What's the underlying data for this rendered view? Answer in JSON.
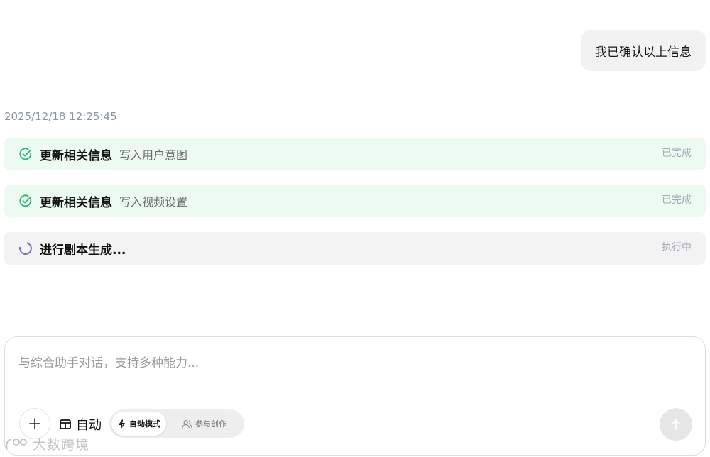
{
  "user_message": {
    "text": "我已确认以上信息"
  },
  "timestamp": "2025/12/18 12:25:45",
  "tasks": [
    {
      "title": "更新相关信息",
      "detail": "写入用户意图",
      "status": "已完成",
      "state": "done"
    },
    {
      "title": "更新相关信息",
      "detail": "写入视频设置",
      "status": "已完成",
      "state": "done"
    },
    {
      "title": "进行剧本生成...",
      "detail": "",
      "status": "执行中",
      "state": "running"
    }
  ],
  "composer": {
    "placeholder": "与综合助手对话，支持多种能力...",
    "auto_label": "自动",
    "modes": {
      "active_label": "自动模式",
      "inactive_label": "参与创作"
    }
  },
  "watermark": {
    "text": "大数跨境"
  },
  "colors": {
    "success_green": "#2bb673",
    "spinner_purple": "#7b6fd6",
    "done_row_bg": "#ecfaf1",
    "running_row_bg": "#f3f3f3",
    "status_text": "#a2a9b6",
    "timestamp_text": "#8a93a6"
  },
  "icons": {
    "done": "check-circle-icon",
    "running": "spinner-icon",
    "add": "plus-icon",
    "auto": "layout-icon",
    "auto_mode": "lightning-icon",
    "co_create": "users-icon",
    "send": "arrow-up-icon"
  }
}
